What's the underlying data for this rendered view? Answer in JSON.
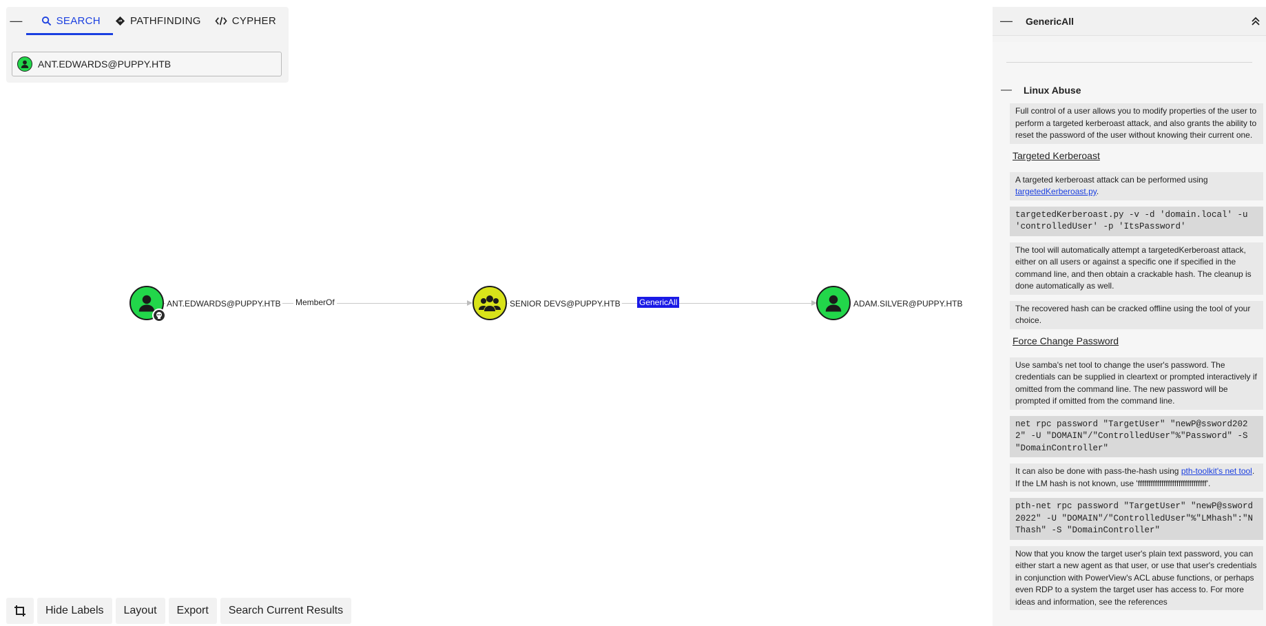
{
  "search_panel": {
    "tabs": [
      {
        "label": "SEARCH",
        "icon": "search-icon"
      },
      {
        "label": "PATHFINDING",
        "icon": "pathfinding-icon"
      },
      {
        "label": "CYPHER",
        "icon": "code-icon"
      }
    ],
    "search_value": "ANT.EDWARDS@PUPPY.HTB"
  },
  "graph": {
    "nodes": [
      {
        "label": "ANT.EDWARDS@PUPPY.HTB",
        "type": "user",
        "color": "#22d64a",
        "owned": true
      },
      {
        "label": "SENIOR DEVS@PUPPY.HTB",
        "type": "group",
        "color": "#d8e31a"
      },
      {
        "label": "ADAM.SILVER@PUPPY.HTB",
        "type": "user",
        "color": "#22d64a"
      }
    ],
    "edges": [
      {
        "label": "MemberOf",
        "selected": false
      },
      {
        "label": "GenericAll",
        "selected": true
      }
    ]
  },
  "toolbar": {
    "crop_icon": "crop-icon",
    "hide_labels": "Hide Labels",
    "layout": "Layout",
    "export": "Export",
    "search_results": "Search Current Results"
  },
  "right_panel": {
    "title": "GenericAll",
    "section": "Linux Abuse",
    "p1": "Full control of a user allows you to modify properties of the user to perform a targeted kerberoast attack, and also grants the ability to reset the password of the user without knowing their current one.",
    "h_kerberoast": "Targeted Kerberoast",
    "p2_text": "A targeted kerberoast attack can be performed using ",
    "p2_link": "targetedKerberoast.py",
    "p2_end": ".",
    "code1": "targetedKerberoast.py -v -d 'domain.local' -u 'controlledUser' -p 'ItsPassword'",
    "p3": "The tool will automatically attempt a targetedKerberoast attack, either on all users or against a specific one if specified in the command line, and then obtain a crackable hash. The cleanup is done automatically as well.",
    "p4": "The recovered hash can be cracked offline using the tool of your choice.",
    "h_force": "Force Change Password",
    "p5": "Use samba's net tool to change the user's password. The credentials can be supplied in cleartext or prompted interactively if omitted from the command line. The new password will be prompted if omitted from the command line.",
    "code2": "net rpc password \"TargetUser\" \"newP@ssword2022\" -U \"DOMAIN\"/\"ControlledUser\"%\"Password\" -S \"DomainController\"",
    "p6_text": "It can also be done with pass-the-hash using ",
    "p6_link": "pth-toolkit's net tool",
    "p6_end": ". If the LM hash is not known, use 'ffffffffffffffffffffffffffffffff'.",
    "code3": "pth-net rpc password \"TargetUser\" \"newP@ssword2022\" -U \"DOMAIN\"/\"ControlledUser\"%\"LMhash\":\"NThash\" -S \"DomainController\"",
    "p7": "Now that you know the target user's plain text password, you can either start a new agent as that user, or use that user's credentials in conjunction with PowerView's ACL abuse functions, or perhaps even RDP to a system the target user has access to. For more ideas and information, see the references"
  }
}
